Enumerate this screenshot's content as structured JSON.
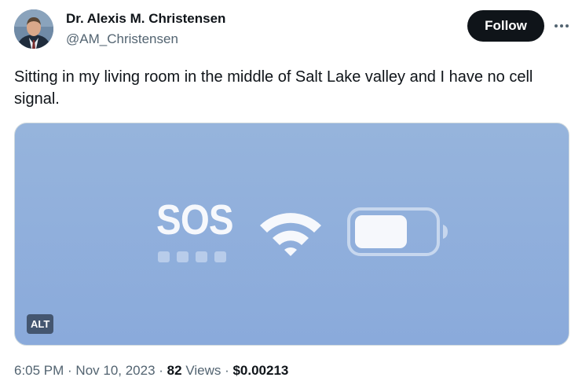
{
  "author": {
    "name": "Dr. Alexis M. Christensen",
    "handle": "@AM_Christensen",
    "avatar_icon": "profile-photo"
  },
  "actions": {
    "follow_label": "Follow",
    "more_icon": "more-horizontal-icon"
  },
  "tweet": {
    "text": "Sitting in my living room in the middle of Salt Lake valley and I have no cell signal."
  },
  "media": {
    "status_text": "SOS",
    "signal_bars": 4,
    "wifi_icon": "wifi-icon",
    "battery_icon": "battery-icon",
    "alt_label": "ALT",
    "background_color": "#8fafdc"
  },
  "meta": {
    "time": "6:05 PM",
    "separator1": " · ",
    "date": "Nov 10, 2023",
    "separator2": " · ",
    "views_count": "82",
    "views_label": " Views",
    "separator3": " · ",
    "price": "$0.00213"
  }
}
